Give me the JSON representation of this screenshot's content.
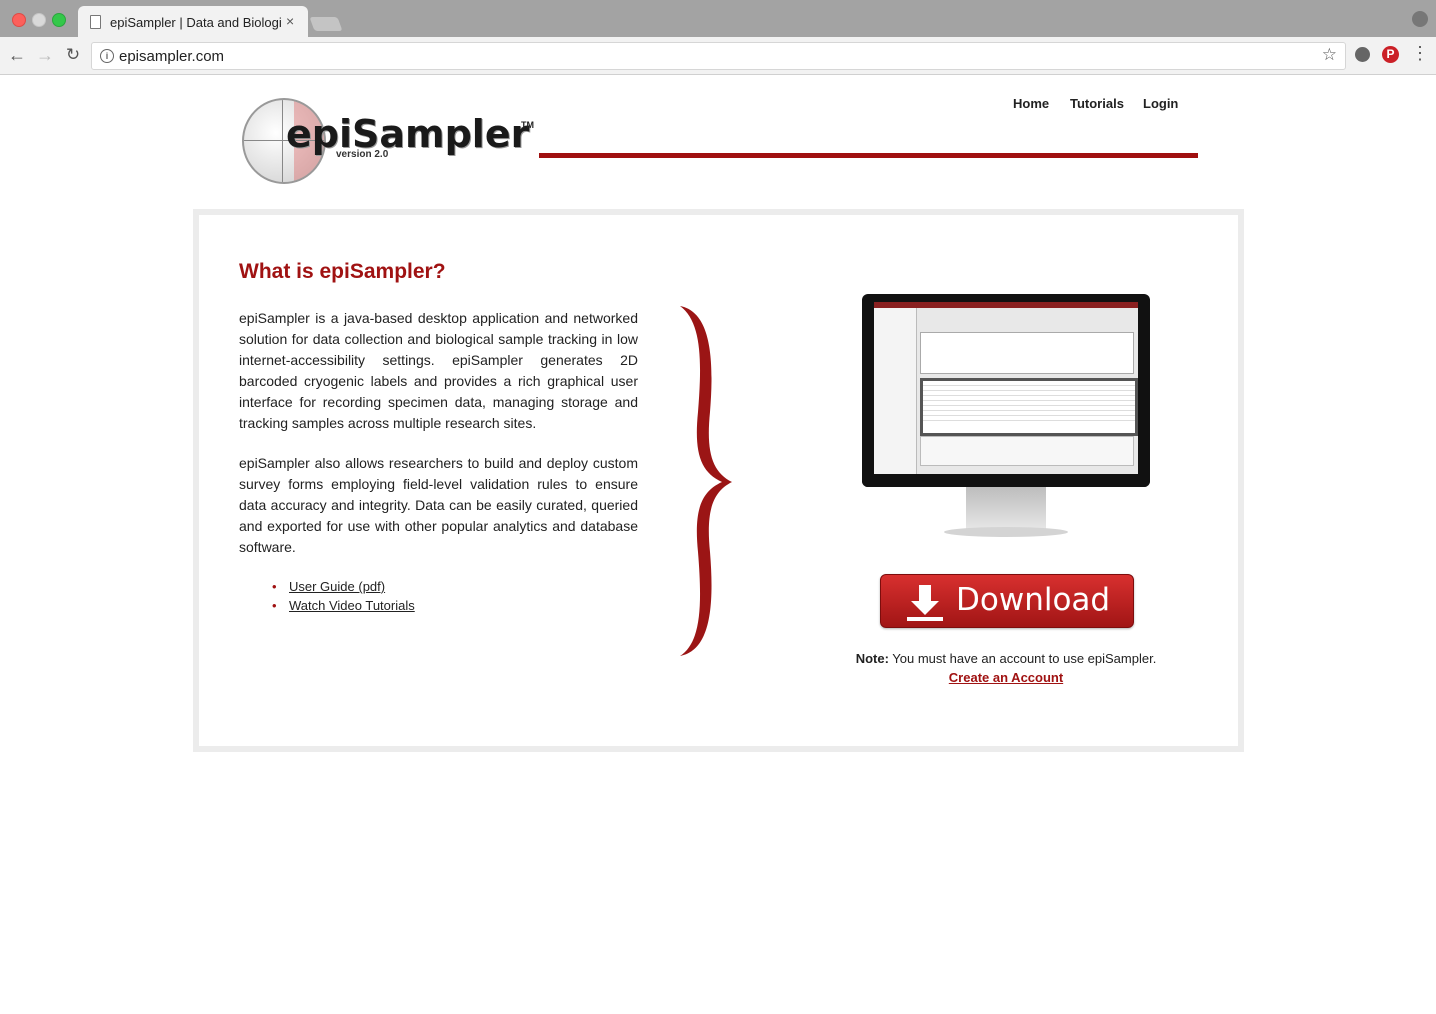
{
  "browser": {
    "tab_title": "epiSampler | Data and Biologic",
    "tab_close": "×",
    "url": "episampler.com",
    "omnibox_info": "i",
    "bookmark_star": "☆",
    "back": "←",
    "forward": "→",
    "reload": "↻",
    "pinterest": "P",
    "menu": "⋮"
  },
  "logo": {
    "wordmark": "epiSampler",
    "tm": "TM",
    "version": "version 2.0"
  },
  "nav": {
    "home": "Home",
    "tutorials": "Tutorials",
    "login": "Login"
  },
  "main": {
    "heading": "What is epiSampler?",
    "para1": "epiSampler is a java-based desktop application and networked solution for data collection and biological sample tracking in low internet-accessibility settings. epiSampler generates 2D barcoded cryogenic labels and provides a rich graphical user interface for recording specimen data, managing storage and tracking samples across multiple research sites.",
    "para2": "epiSampler also allows researchers to build and deploy custom survey forms employing field-level validation rules to ensure data accuracy and integrity. Data can be easily curated, queried and exported for use with other popular analytics and database software.",
    "links": [
      {
        "label": "User Guide (pdf)"
      },
      {
        "label": "Watch Video Tutorials"
      }
    ],
    "bullet": "•"
  },
  "download": {
    "label": "Download",
    "note_bold": "Note:",
    "note_text": " You must have an account to use epiSampler.",
    "create_account": "Create an Account"
  },
  "colors": {
    "accent": "#a01212",
    "chrome": "#a3a3a3"
  }
}
